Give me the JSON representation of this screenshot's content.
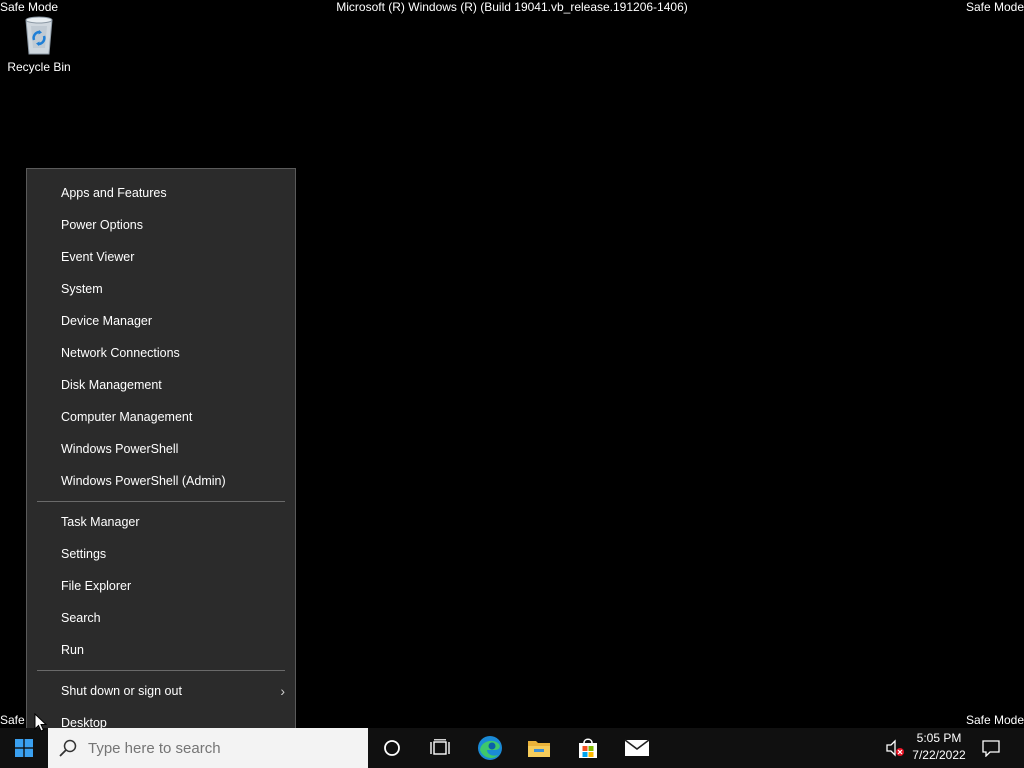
{
  "watermark": {
    "safe_mode": "Safe Mode",
    "safe_mode_bottom_left": "Safe",
    "build": "Microsoft (R) Windows (R) (Build 19041.vb_release.191206-1406)"
  },
  "desktop": {
    "icons": [
      {
        "label": "Recycle Bin",
        "icon": "recycle-bin-icon"
      }
    ]
  },
  "context_menu": {
    "group1": [
      "Apps and Features",
      "Power Options",
      "Event Viewer",
      "System",
      "Device Manager",
      "Network Connections",
      "Disk Management",
      "Computer Management",
      "Windows PowerShell",
      "Windows PowerShell (Admin)"
    ],
    "group2": [
      "Task Manager",
      "Settings",
      "File Explorer",
      "Search",
      "Run"
    ],
    "group3": [
      {
        "label": "Shut down or sign out",
        "has_submenu": true
      },
      {
        "label": "Desktop",
        "has_submenu": false
      }
    ]
  },
  "taskbar": {
    "search_placeholder": "Type here to search",
    "pinned": [
      "cortana-icon",
      "task-view-icon",
      "edge-icon",
      "file-explorer-icon",
      "store-icon",
      "mail-icon"
    ],
    "tray": {
      "volume_icon": "volume-muted-icon",
      "time": "5:05 PM",
      "date": "7/22/2022",
      "notification_icon": "action-center-icon"
    }
  },
  "colors": {
    "desktop": "#000000",
    "menu_bg": "#2b2b2b",
    "taskbar_bg": "#101010",
    "windows_blue": "#0a84d6"
  }
}
